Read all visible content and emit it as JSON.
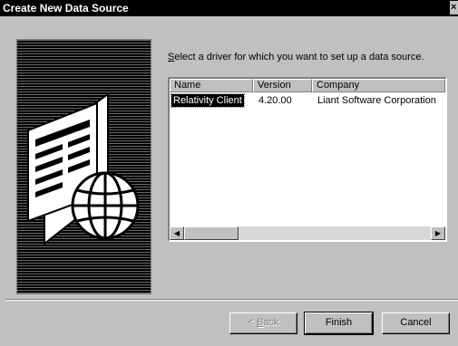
{
  "window": {
    "title": "Create New Data Source",
    "close_glyph": "×"
  },
  "dialog": {
    "prompt_accesskey": "S",
    "prompt_rest": "elect a driver for which you want to set up a data source."
  },
  "list": {
    "columns": [
      "Name",
      "Version",
      "Company"
    ],
    "rows": [
      {
        "name": "Relativity Client",
        "version": "4.20.00",
        "company": "Liant Software Corporation"
      }
    ],
    "selected_row": 0,
    "scroll_left_glyph": "◀",
    "scroll_right_glyph": "▶"
  },
  "buttons": {
    "back_prefix": "< ",
    "back_accesskey": "B",
    "back_rest": "ack",
    "finish": "Finish",
    "cancel": "Cancel"
  },
  "icons": {
    "illustration": "data-source-illustration-icon",
    "globe": "globe-icon"
  },
  "colors": {
    "dialog_bg": "#c0c0c0",
    "title_bg": "#000000",
    "selection_bg": "#000000",
    "disabled_text": "#808080"
  }
}
